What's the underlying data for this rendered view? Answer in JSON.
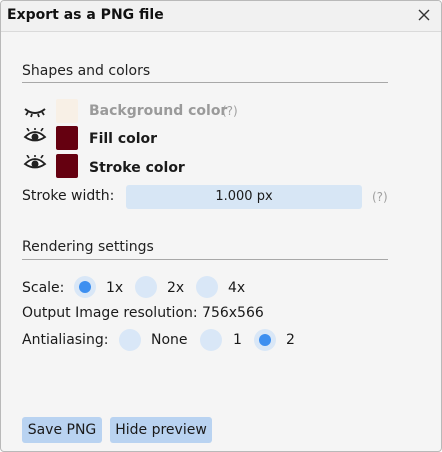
{
  "dialog": {
    "title": "Export as a PNG file",
    "close_icon": "close-icon"
  },
  "shapes": {
    "section_title": "Shapes and colors",
    "background": {
      "label": "Background color",
      "visible": false,
      "color": "#f8f0e6",
      "help": "(?)"
    },
    "fill": {
      "label": "Fill color",
      "visible": true,
      "color": "#650010"
    },
    "stroke": {
      "label": "Stroke color",
      "visible": true,
      "color": "#650010"
    },
    "stroke_width": {
      "label": "Stroke width:",
      "value": "1.000 px",
      "help": "(?)"
    }
  },
  "rendering": {
    "section_title": "Rendering settings",
    "scale": {
      "label": "Scale:",
      "options": [
        "1x",
        "2x",
        "4x"
      ],
      "selected": "1x"
    },
    "resolution": "Output Image resolution: 756x566",
    "antialiasing": {
      "label": "Antialiasing:",
      "options": [
        "None",
        "1",
        "2"
      ],
      "selected": "2"
    }
  },
  "buttons": {
    "save": "Save PNG",
    "hide_preview": "Hide preview"
  },
  "colors": {
    "accent": "#3d8ff0",
    "radio_bg": "#d9e7f7",
    "button_bg": "#b9d3f1"
  }
}
